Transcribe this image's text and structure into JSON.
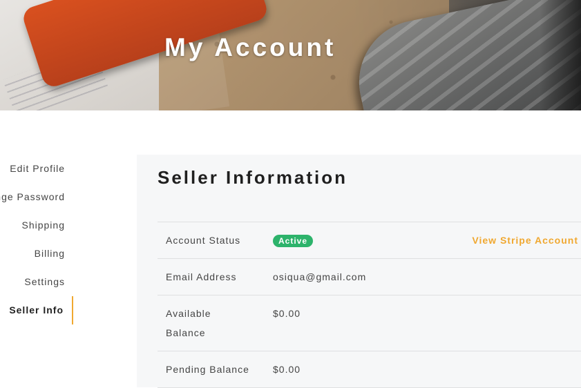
{
  "header": {
    "title": "My Account"
  },
  "sidebar": {
    "items": [
      {
        "label": "Edit Profile",
        "active": false
      },
      {
        "label": "Change Password",
        "active": false
      },
      {
        "label": "Shipping",
        "active": false
      },
      {
        "label": "Billing",
        "active": false
      },
      {
        "label": "Settings",
        "active": false
      },
      {
        "label": "Seller Info",
        "active": true
      }
    ]
  },
  "main": {
    "title": "Seller Information",
    "rows": {
      "account_status": {
        "label": "Account Status",
        "value": "Active",
        "link": "View Stripe Account"
      },
      "email": {
        "label": "Email Address",
        "value": "osiqua@gmail.com"
      },
      "available_balance": {
        "label": "Available Balance",
        "value": "$0.00"
      },
      "pending_balance": {
        "label": "Pending Balance",
        "value": "$0.00"
      }
    }
  },
  "colors": {
    "accent": "#f0a830",
    "status_active": "#2db36b",
    "panel_bg": "#f6f7f8"
  }
}
